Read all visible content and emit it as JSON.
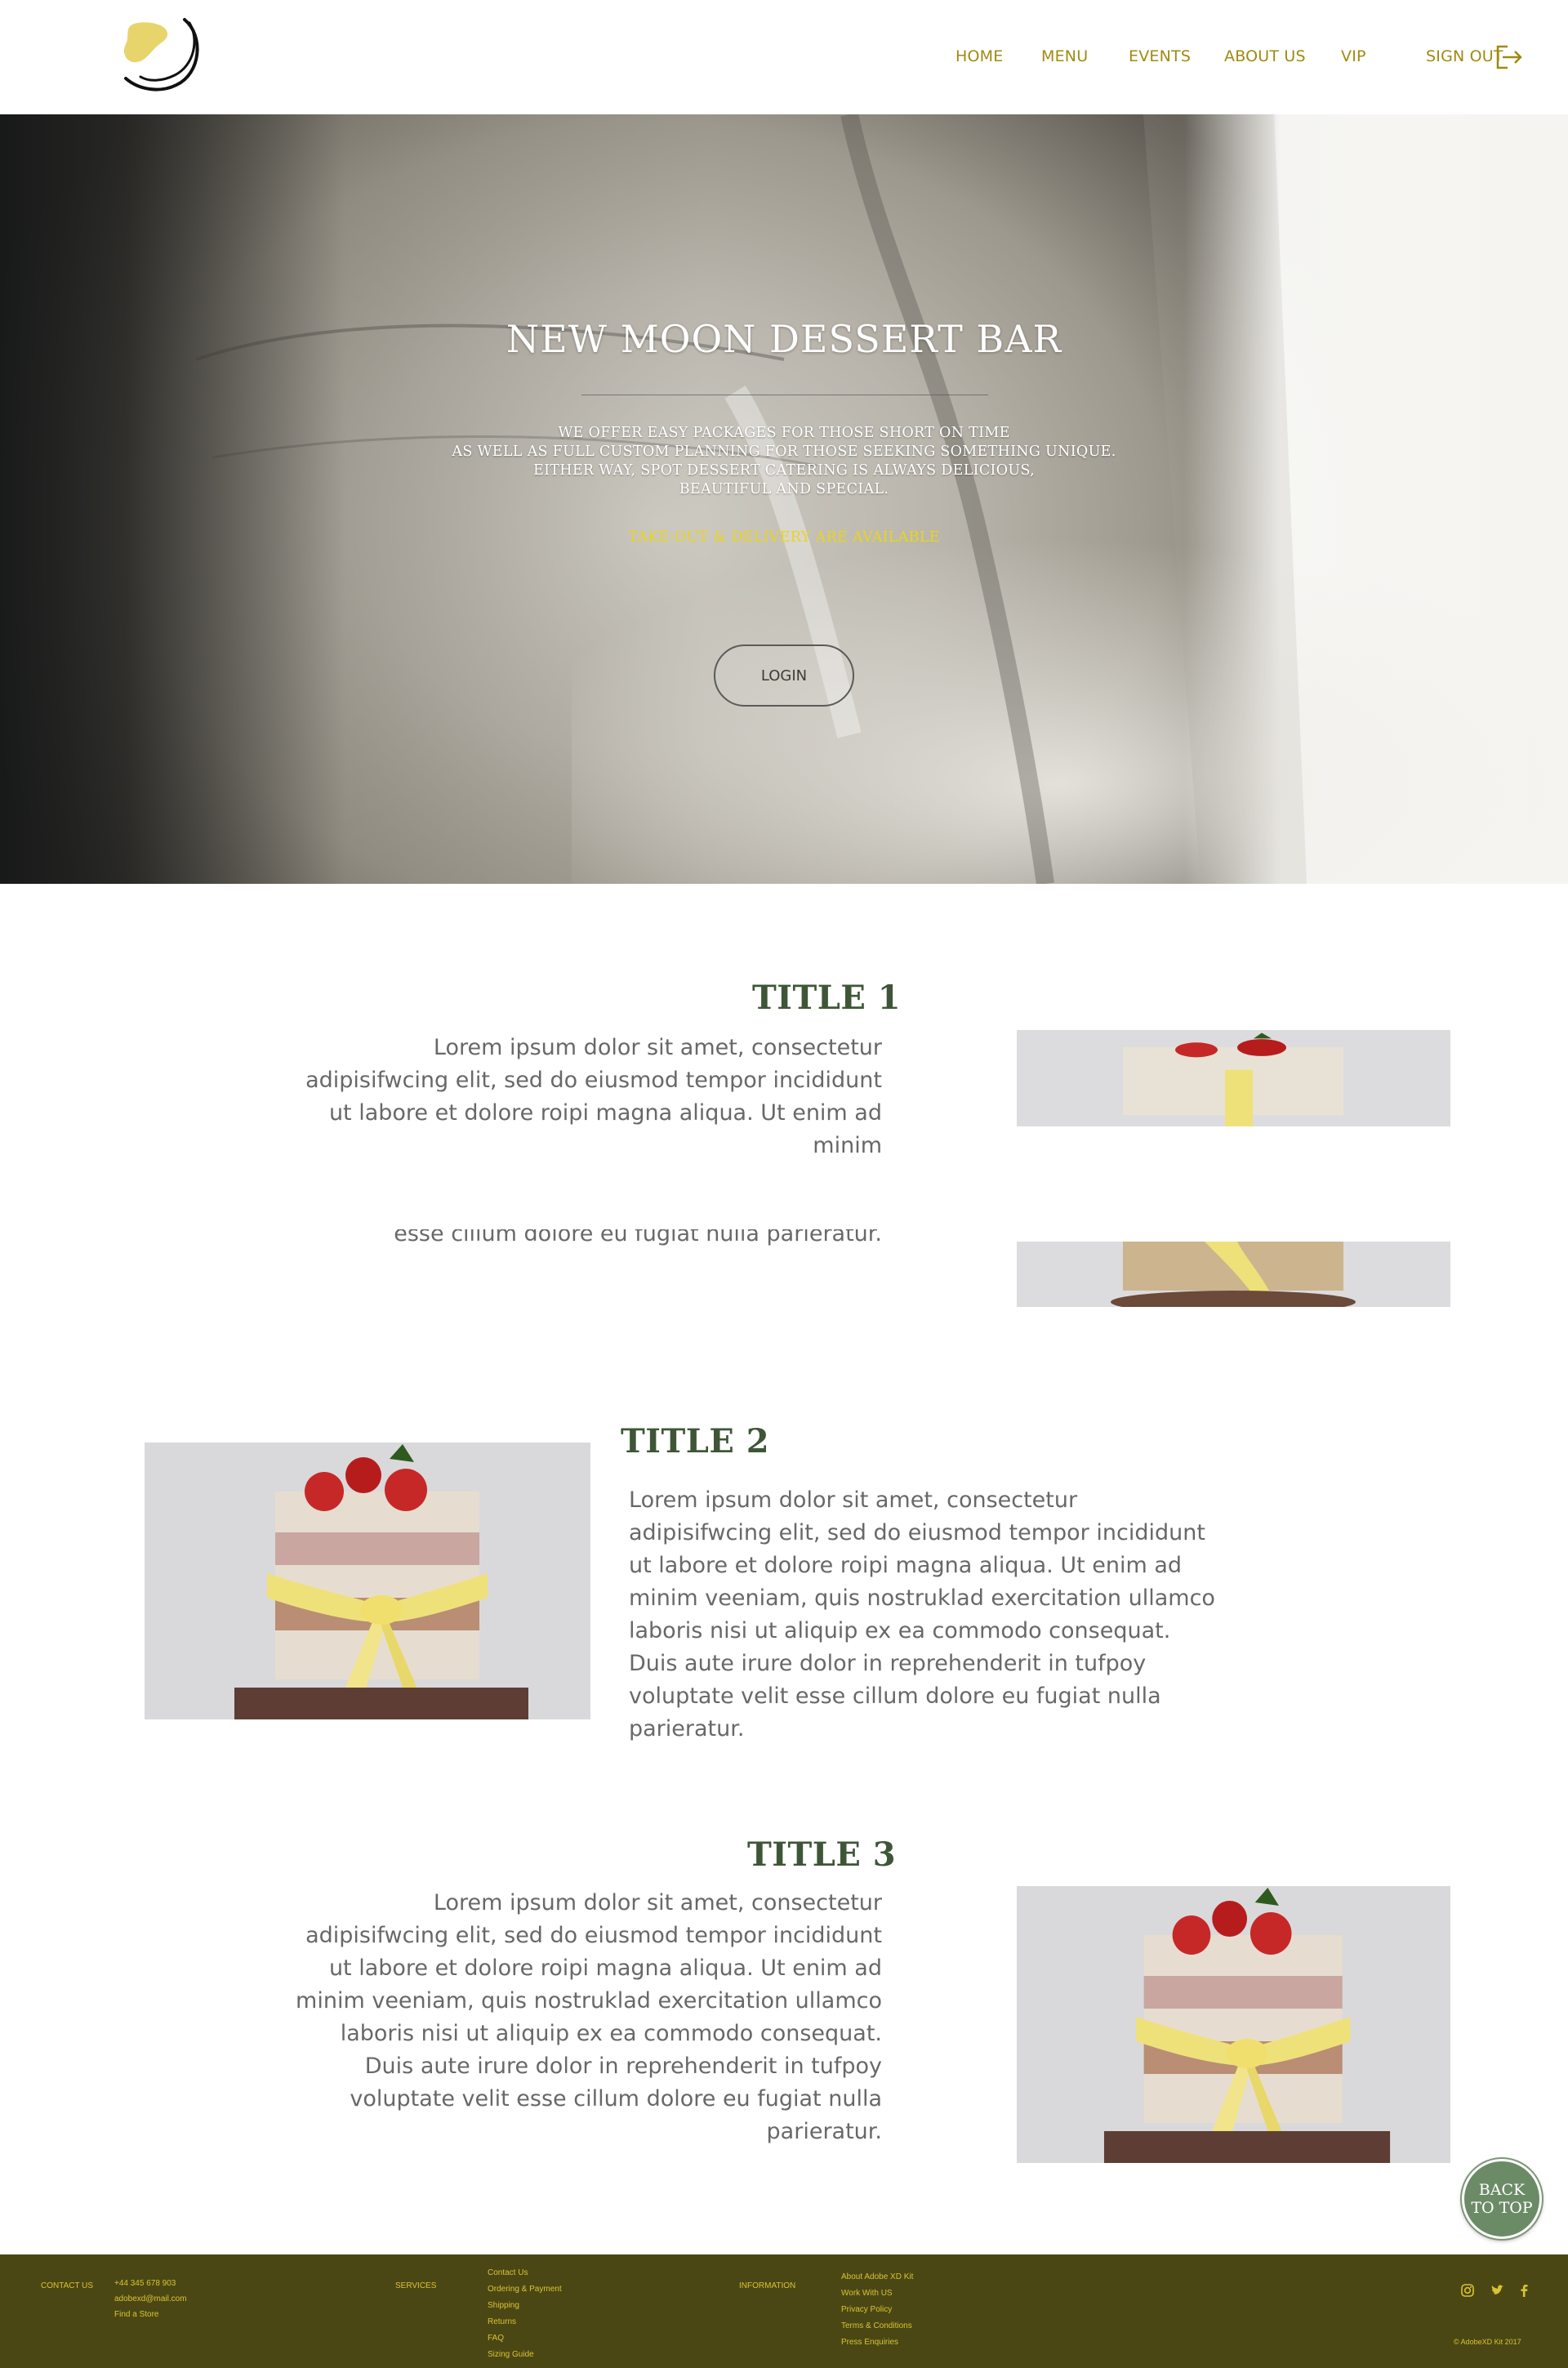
{
  "nav": {
    "items": [
      {
        "label": "HOME"
      },
      {
        "label": "MENU"
      },
      {
        "label": "EVENTS"
      },
      {
        "label": "ABOUT US"
      },
      {
        "label": "VIP"
      }
    ],
    "signout_label": "SIGN OUT",
    "signout_icon": "sign-out-icon",
    "logo_icon": "moon-logo-icon"
  },
  "hero": {
    "title": "NEW MOON DESSERT BAR",
    "lines": [
      "WE OFFER EASY PACKAGES FOR THOSE SHORT ON TIME",
      "AS WELL AS FULL CUSTOM PLANNING FOR THOSE SEEKING SOMETHING UNIQUE.",
      "EITHER WAY, SPOT DESSERT CATERING IS ALWAYS DELICIOUS,",
      "BEAUTIFUL AND SPECIAL."
    ],
    "note": "TAKE-OUT & DELIVERY ARE AVAILABLE",
    "login_label": "LOGIN"
  },
  "sections": [
    {
      "title": "TITLE 1",
      "text": "Lorem ipsum dolor sit amet, consectetur adipisifwcing elit, sed do eiusmod tempor incididunt ut labore et dolore roipi magna aliqua. Ut enim ad minim",
      "tail": "esse cillum dolore eu fugiat nulla parieratur."
    },
    {
      "title": "TITLE 2",
      "text": "Lorem ipsum dolor sit amet, consectetur adipisifwcing elit, sed do eiusmod tempor incididunt ut labore et dolore roipi magna aliqua. Ut enim ad minim veeniam, quis nostruklad exercitation ullamco laboris nisi ut aliquip ex ea commodo consequat. Duis aute irure dolor in reprehenderit in tufpoy voluptate velit esse cillum dolore eu fugiat nulla parieratur."
    },
    {
      "title": "TITLE 3",
      "text": "Lorem ipsum dolor sit amet, consectetur adipisifwcing elit, sed do eiusmod tempor incididunt ut labore et dolore roipi magna aliqua. Ut enim ad minim veeniam, quis nostruklad exercitation ullamco laboris nisi ut aliquip ex ea commodo consequat. Duis aute irure dolor in reprehenderit in tufpoy voluptate velit esse cillum dolore eu fugiat nulla parieratur."
    }
  ],
  "back_to_top_label": "BACK TO TOP",
  "footer": {
    "contact_heading": "CONTACT US",
    "contact_items": [
      "+44 345 678 903",
      "adobexd@mail.com",
      "Find a Store"
    ],
    "services_heading": "SERVICES",
    "services_items": [
      "Contact Us",
      "Ordering & Payment",
      "Shipping",
      "Returns",
      "FAQ",
      "Sizing Guide"
    ],
    "information_heading": "INFORMATION",
    "information_items": [
      "About Adobe XD Kit",
      "Work With US",
      "Privacy Policy",
      "Terms & Conditions",
      "Press Enquiries"
    ],
    "social_icons": [
      "instagram-icon",
      "twitter-icon",
      "facebook-icon"
    ],
    "copyright": "© AdobeXD Kit 2017"
  },
  "colors": {
    "accent": "#a08a10",
    "title_green": "#3e5637",
    "footer_bg": "#4b4715",
    "footer_text": "#d9c430",
    "hero_note": "#e9d51a",
    "back_to_top": "#6b8b66"
  }
}
